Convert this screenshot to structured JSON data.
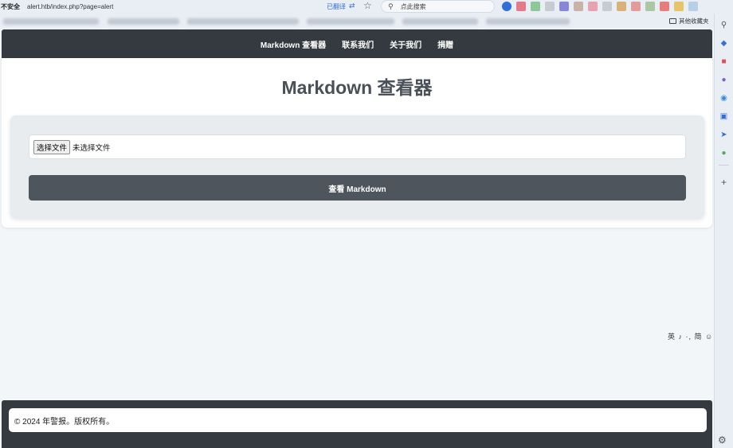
{
  "browser": {
    "security_label": "不安全",
    "url": "alert.htb/index.php?page=alert",
    "translated_label": "已翻译",
    "search_placeholder": "点此搜索",
    "other_bookmarks": "其他收藏夹"
  },
  "nav": {
    "items": [
      {
        "label": "Markdown 查看器"
      },
      {
        "label": "联系我们"
      },
      {
        "label": "关于我们"
      },
      {
        "label": "捐赠"
      }
    ]
  },
  "main": {
    "title": "Markdown 查看器",
    "file_button": "选择文件",
    "file_status": "未选择文件",
    "submit_label": "查看 Markdown"
  },
  "side_widget": "英 ♪ ·, 简 ☺",
  "footer": {
    "text": "© 2024 年警报。版权所有。"
  },
  "colors": {
    "navbar": "#343a40",
    "button": "#4f555c",
    "title": "#495057",
    "form_bg": "#e9ecef"
  }
}
